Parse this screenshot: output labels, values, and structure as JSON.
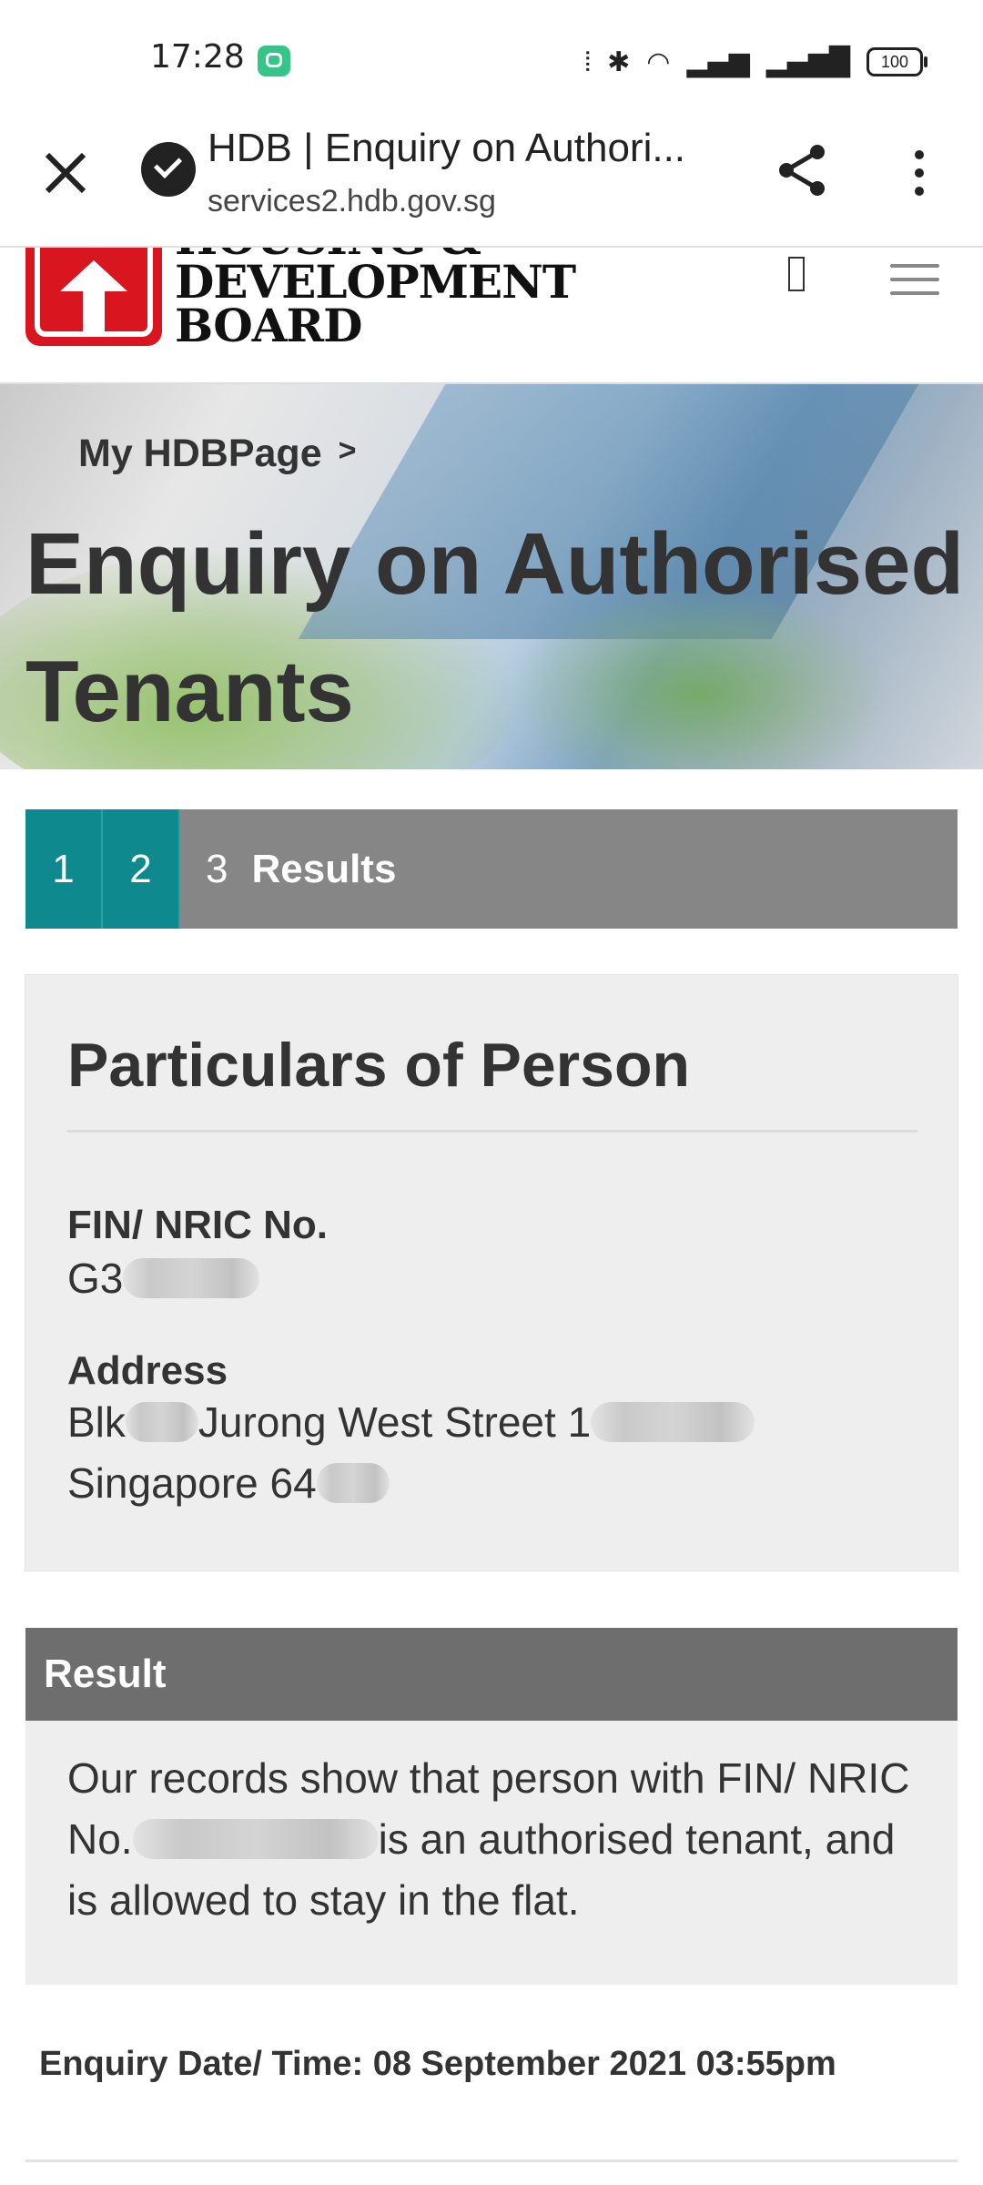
{
  "status_bar": {
    "time": "17:28",
    "icons": [
      "message-app-icon",
      "vibrate-icon",
      "bluetooth-icon",
      "wifi-icon",
      "signal-4g-icon",
      "signal-3g-icon"
    ],
    "battery": "100"
  },
  "browser": {
    "page_title": "HDB | Enquiry on Authori...",
    "url": "services2.hdb.gov.sg"
  },
  "site": {
    "brand_lines": [
      "HOUSING &",
      "DEVELOPMENT",
      "BOARD"
    ],
    "brand_color": "#d9161f"
  },
  "hero": {
    "breadcrumb": "My HDBPage",
    "breadcrumb_sep": ">",
    "title": "Enquiry on Authorised Tenants"
  },
  "steps": {
    "items": [
      {
        "number": "1"
      },
      {
        "number": "2"
      },
      {
        "number": "3",
        "label": "Results"
      }
    ],
    "done_color": "#0e8a8f"
  },
  "particulars": {
    "title": "Particulars of Person",
    "nric_label": "FIN/ NRIC No.",
    "nric_value": "G3",
    "address_label": "Address",
    "address_line1_prefix": "Blk",
    "address_line1_street": "Jurong West Street 1",
    "address_line2": "Singapore 64"
  },
  "result": {
    "heading": "Result",
    "text_part1": "Our records show that person with FIN/ NRIC No.",
    "text_part2": "is an authorised tenant, and is allowed to stay in the flat."
  },
  "enquiry": {
    "text": "Enquiry Date/ Time: 08 September 2021 03:55pm"
  }
}
